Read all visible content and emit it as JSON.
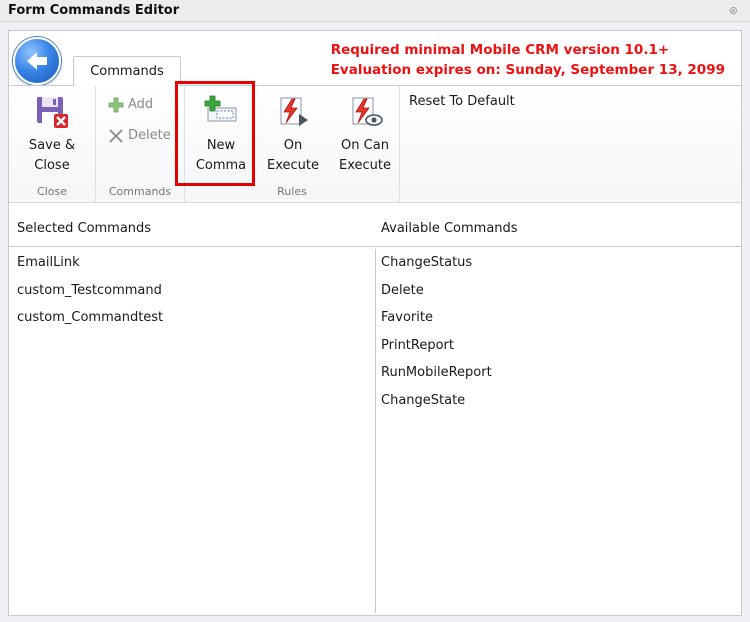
{
  "window": {
    "title": "Form Commands Editor",
    "close_glyph": "⊗"
  },
  "notice": {
    "line1": "Required minimal Mobile CRM version 10.1+",
    "line2": "Evaluation expires on: Sunday, September 13, 2099",
    "color": "#ee1111"
  },
  "tab": {
    "label": "Commands"
  },
  "ribbon": {
    "close_group": {
      "label": "Close",
      "save_close": {
        "line1": "Save &",
        "line2": "Close",
        "icon": "floppy-disk-icon"
      }
    },
    "commands_group": {
      "label": "Commands",
      "add": {
        "label": "Add",
        "icon": "plus-icon"
      },
      "delete": {
        "label": "Delete",
        "icon": "x-icon"
      }
    },
    "rules_group": {
      "label": "Rules",
      "new_command": {
        "line1": "New",
        "line2": "Comma",
        "icon": "new-command-icon"
      },
      "on_execute": {
        "line1": "On",
        "line2": "Execute",
        "icon": "lightning-play-icon"
      },
      "on_can_execute": {
        "line1": "On Can",
        "line2": "Execute",
        "icon": "lightning-eye-icon"
      }
    },
    "reset": {
      "label": "Reset To Default"
    }
  },
  "selected": {
    "header": "Selected Commands",
    "items": [
      "EmailLink",
      "custom_Testcommand",
      "custom_Commandtest"
    ]
  },
  "available": {
    "header": "Available Commands",
    "items": [
      "ChangeStatus",
      "Delete",
      "Favorite",
      "PrintReport",
      "RunMobileReport",
      "ChangeState"
    ]
  }
}
